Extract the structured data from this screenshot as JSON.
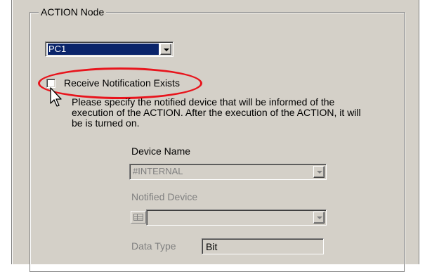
{
  "group": {
    "title": "ACTION Node"
  },
  "node_select": {
    "value": "PC1"
  },
  "notification": {
    "checkbox_label": "Receive Notification Exists",
    "checked": false,
    "description": "Please specify the notified device that will be informed of the execution of the ACTION. After the execution of the ACTION, it will be is turned on."
  },
  "device_name": {
    "label": "Device Name",
    "value": "#INTERNAL"
  },
  "notified_device": {
    "label": "Notified Device",
    "value": ""
  },
  "data_type": {
    "label": "Data Type",
    "value": "Bit"
  },
  "colors": {
    "highlight": "#e8141c",
    "selection": "#0a246a",
    "face": "#d4d0c8"
  },
  "icons": [
    "chevron-down-icon",
    "device-address-icon",
    "mouse-pointer-icon"
  ]
}
